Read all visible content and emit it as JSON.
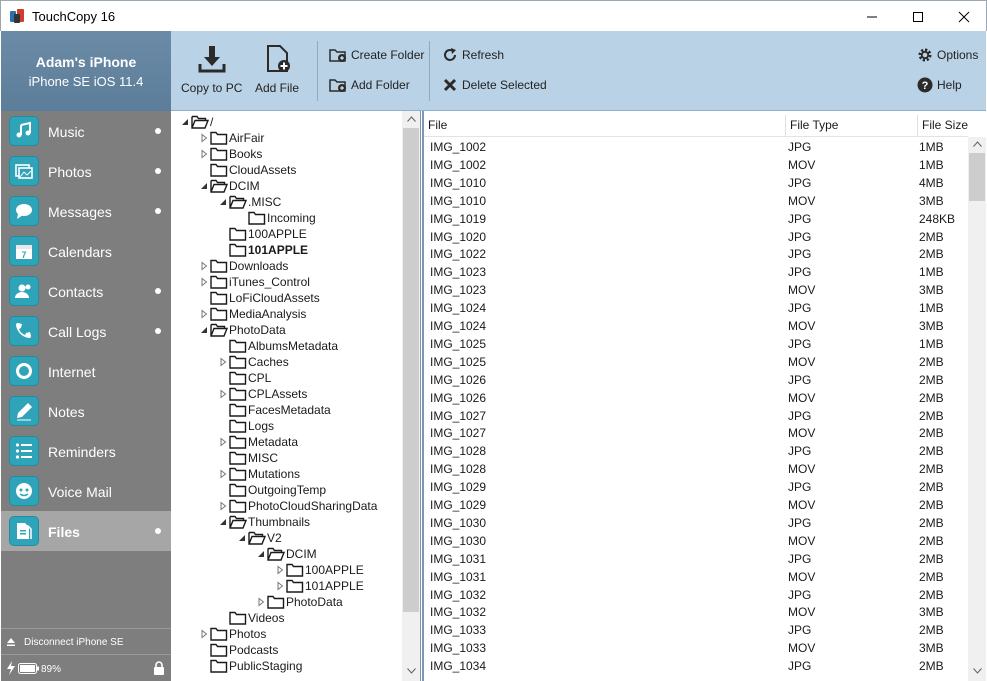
{
  "window": {
    "title": "TouchCopy 16"
  },
  "device": {
    "name": "Adam's iPhone",
    "model": "iPhone SE iOS 11.4"
  },
  "toolbar": {
    "copy_to_pc": "Copy to PC",
    "add_file": "Add File",
    "create_folder": "Create Folder",
    "add_folder": "Add Folder",
    "refresh": "Refresh",
    "delete_selected": "Delete Selected",
    "options": "Options",
    "help": "Help"
  },
  "sidebar": {
    "items": [
      {
        "label": "Music",
        "icon": "music-icon",
        "dot": true
      },
      {
        "label": "Photos",
        "icon": "photos-icon",
        "dot": true
      },
      {
        "label": "Messages",
        "icon": "messages-icon",
        "dot": true
      },
      {
        "label": "Calendars",
        "icon": "calendar-icon",
        "dot": false
      },
      {
        "label": "Contacts",
        "icon": "contacts-icon",
        "dot": true
      },
      {
        "label": "Call Logs",
        "icon": "phone-icon",
        "dot": true
      },
      {
        "label": "Internet",
        "icon": "internet-icon",
        "dot": false
      },
      {
        "label": "Notes",
        "icon": "notes-icon",
        "dot": false
      },
      {
        "label": "Reminders",
        "icon": "reminders-icon",
        "dot": false
      },
      {
        "label": "Voice Mail",
        "icon": "voicemail-icon",
        "dot": false
      },
      {
        "label": "Files",
        "icon": "files-icon",
        "dot": true,
        "active": true
      }
    ],
    "disconnect": "Disconnect iPhone SE",
    "battery": "89%"
  },
  "tree": [
    {
      "name": "/",
      "expanded": true,
      "level": 0
    },
    {
      "name": "AirFair",
      "expandable": true,
      "level": 1
    },
    {
      "name": "Books",
      "expandable": true,
      "level": 1
    },
    {
      "name": "CloudAssets",
      "level": 1
    },
    {
      "name": "DCIM",
      "expanded": true,
      "level": 1
    },
    {
      "name": ".MISC",
      "expanded": true,
      "level": 2
    },
    {
      "name": "Incoming",
      "level": 3
    },
    {
      "name": "100APPLE",
      "level": 2
    },
    {
      "name": "101APPLE",
      "level": 2,
      "bold": true
    },
    {
      "name": "Downloads",
      "expandable": true,
      "level": 1
    },
    {
      "name": "iTunes_Control",
      "expandable": true,
      "level": 1
    },
    {
      "name": "LoFiCloudAssets",
      "level": 1
    },
    {
      "name": "MediaAnalysis",
      "expandable": true,
      "level": 1
    },
    {
      "name": "PhotoData",
      "expanded": true,
      "level": 1
    },
    {
      "name": "AlbumsMetadata",
      "level": 2
    },
    {
      "name": "Caches",
      "expandable": true,
      "level": 2
    },
    {
      "name": "CPL",
      "level": 2
    },
    {
      "name": "CPLAssets",
      "expandable": true,
      "level": 2
    },
    {
      "name": "FacesMetadata",
      "level": 2
    },
    {
      "name": "Logs",
      "level": 2
    },
    {
      "name": "Metadata",
      "expandable": true,
      "level": 2
    },
    {
      "name": "MISC",
      "level": 2
    },
    {
      "name": "Mutations",
      "expandable": true,
      "level": 2
    },
    {
      "name": "OutgoingTemp",
      "level": 2
    },
    {
      "name": "PhotoCloudSharingData",
      "expandable": true,
      "level": 2
    },
    {
      "name": "Thumbnails",
      "expanded": true,
      "level": 2
    },
    {
      "name": "V2",
      "expanded": true,
      "level": 3
    },
    {
      "name": "DCIM",
      "expanded": true,
      "level": 4
    },
    {
      "name": "100APPLE",
      "expandable": true,
      "level": 5
    },
    {
      "name": "101APPLE",
      "expandable": true,
      "level": 5
    },
    {
      "name": "PhotoData",
      "expandable": true,
      "level": 4
    },
    {
      "name": "Videos",
      "level": 2
    },
    {
      "name": "Photos",
      "expandable": true,
      "level": 1
    },
    {
      "name": "Podcasts",
      "level": 1
    },
    {
      "name": "PublicStaging",
      "level": 1
    }
  ],
  "files": {
    "columns": [
      "File",
      "File Type",
      "File Size"
    ],
    "rows": [
      [
        "IMG_1002",
        "JPG",
        "1MB"
      ],
      [
        "IMG_1002",
        "MOV",
        "1MB"
      ],
      [
        "IMG_1010",
        "JPG",
        "4MB"
      ],
      [
        "IMG_1010",
        "MOV",
        "3MB"
      ],
      [
        "IMG_1019",
        "JPG",
        "248KB"
      ],
      [
        "IMG_1020",
        "JPG",
        "2MB"
      ],
      [
        "IMG_1022",
        "JPG",
        "2MB"
      ],
      [
        "IMG_1023",
        "JPG",
        "1MB"
      ],
      [
        "IMG_1023",
        "MOV",
        "3MB"
      ],
      [
        "IMG_1024",
        "JPG",
        "1MB"
      ],
      [
        "IMG_1024",
        "MOV",
        "3MB"
      ],
      [
        "IMG_1025",
        "JPG",
        "1MB"
      ],
      [
        "IMG_1025",
        "MOV",
        "2MB"
      ],
      [
        "IMG_1026",
        "JPG",
        "2MB"
      ],
      [
        "IMG_1026",
        "MOV",
        "2MB"
      ],
      [
        "IMG_1027",
        "JPG",
        "2MB"
      ],
      [
        "IMG_1027",
        "MOV",
        "2MB"
      ],
      [
        "IMG_1028",
        "JPG",
        "2MB"
      ],
      [
        "IMG_1028",
        "MOV",
        "2MB"
      ],
      [
        "IMG_1029",
        "JPG",
        "2MB"
      ],
      [
        "IMG_1029",
        "MOV",
        "2MB"
      ],
      [
        "IMG_1030",
        "JPG",
        "2MB"
      ],
      [
        "IMG_1030",
        "MOV",
        "2MB"
      ],
      [
        "IMG_1031",
        "JPG",
        "2MB"
      ],
      [
        "IMG_1031",
        "MOV",
        "2MB"
      ],
      [
        "IMG_1032",
        "JPG",
        "2MB"
      ],
      [
        "IMG_1032",
        "MOV",
        "3MB"
      ],
      [
        "IMG_1033",
        "JPG",
        "2MB"
      ],
      [
        "IMG_1033",
        "MOV",
        "3MB"
      ],
      [
        "IMG_1034",
        "JPG",
        "2MB"
      ]
    ]
  },
  "colors": {
    "sidebar_bg": "#7e7e7e",
    "sidebar_active": "#a6a6a6",
    "toolbar_bg": "#b9d2e6",
    "device_header": "#62829e",
    "nav_icon": "#2fa4b8"
  }
}
